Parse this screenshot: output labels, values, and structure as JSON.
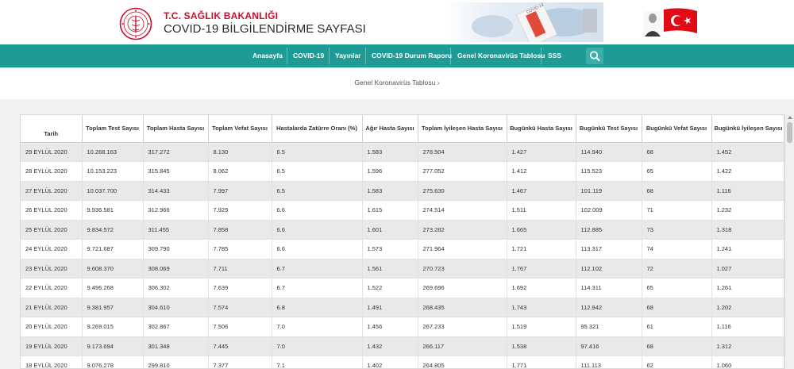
{
  "header": {
    "ministry": "T.C. SAĞLIK BAKANLIĞI",
    "site_title": "COVID-19 BİLGİLENDİRME SAYFASI",
    "banner_text": "COVID-19"
  },
  "nav": {
    "items": [
      "Anasayfa",
      "COVID-19",
      "Yayınlar",
      "COVID-19 Durum Raporu",
      "Genel Koronavirüs Tablosu",
      "SSS"
    ],
    "search_icon": "search-icon"
  },
  "breadcrumb": "Genel Koronavirüs Tablosu ›",
  "colors": {
    "nav": "#1e9b95",
    "brand_red": "#c8102e"
  },
  "table": {
    "headers": [
      "Tarih",
      "Toplam Test Sayısı",
      "Toplam Hasta Sayısı",
      "Toplam Vefat Sayısı",
      "Hastalarda Zatürre Oranı (%)",
      "Ağır Hasta Sayısı",
      "Toplam İyileşen Hasta Sayısı",
      "Bugünkü Hasta Sayısı",
      "Bugünkü Test Sayısı",
      "Bugünkü Vefat Sayısı",
      "Bugünkü İyileşen Sayısı"
    ],
    "rows": [
      [
        "29 EYLÜL 2020",
        "10.268.163",
        "317.272",
        "8.130",
        "6.5",
        "1.583",
        "278.504",
        "1.427",
        "114.940",
        "68",
        "1.452"
      ],
      [
        "28 EYLÜL 2020",
        "10.153.223",
        "315.845",
        "8.062",
        "6.5",
        "1.596",
        "277.052",
        "1.412",
        "115.523",
        "65",
        "1.422"
      ],
      [
        "27 EYLÜL 2020",
        "10.037.700",
        "314.433",
        "7.997",
        "6.5",
        "1.583",
        "275.630",
        "1.467",
        "101.119",
        "68",
        "1.116"
      ],
      [
        "26 EYLÜL 2020",
        "9.936.581",
        "312.966",
        "7.929",
        "6.6",
        "1.615",
        "274.514",
        "1.511",
        "102.009",
        "71",
        "1.232"
      ],
      [
        "25 EYLÜL 2020",
        "9.834.572",
        "311.455",
        "7.858",
        "6.6",
        "1.601",
        "273.282",
        "1.665",
        "112.885",
        "73",
        "1.318"
      ],
      [
        "24 EYLÜL 2020",
        "9.721.687",
        "309.790",
        "7.785",
        "6.6",
        "1.573",
        "271.964",
        "1.721",
        "113.317",
        "74",
        "1.241"
      ],
      [
        "23 EYLÜL 2020",
        "9.608.370",
        "308.069",
        "7.711",
        "6.7",
        "1.561",
        "270.723",
        "1.767",
        "112.102",
        "72",
        "1.027"
      ],
      [
        "22 EYLÜL 2020",
        "9.496.268",
        "306.302",
        "7.639",
        "6.7",
        "1.522",
        "269.696",
        "1.692",
        "114.311",
        "65",
        "1.261"
      ],
      [
        "21 EYLÜL 2020",
        "9.381.957",
        "304.610",
        "7.574",
        "6.8",
        "1.491",
        "268.435",
        "1.743",
        "112.942",
        "68",
        "1.202"
      ],
      [
        "20 EYLÜL 2020",
        "9.269.015",
        "302.867",
        "7.506",
        "7.0",
        "1.456",
        "267.233",
        "1.519",
        "95.321",
        "61",
        "1.116"
      ],
      [
        "19 EYLÜL 2020",
        "9.173.694",
        "301.348",
        "7.445",
        "7.0",
        "1.432",
        "266.117",
        "1.538",
        "97.416",
        "68",
        "1.312"
      ],
      [
        "18 EYLÜL 2020",
        "9.076.278",
        "299.810",
        "7.377",
        "7.1",
        "1.402",
        "264.805",
        "1.771",
        "111.113",
        "62",
        "1.060"
      ]
    ]
  }
}
